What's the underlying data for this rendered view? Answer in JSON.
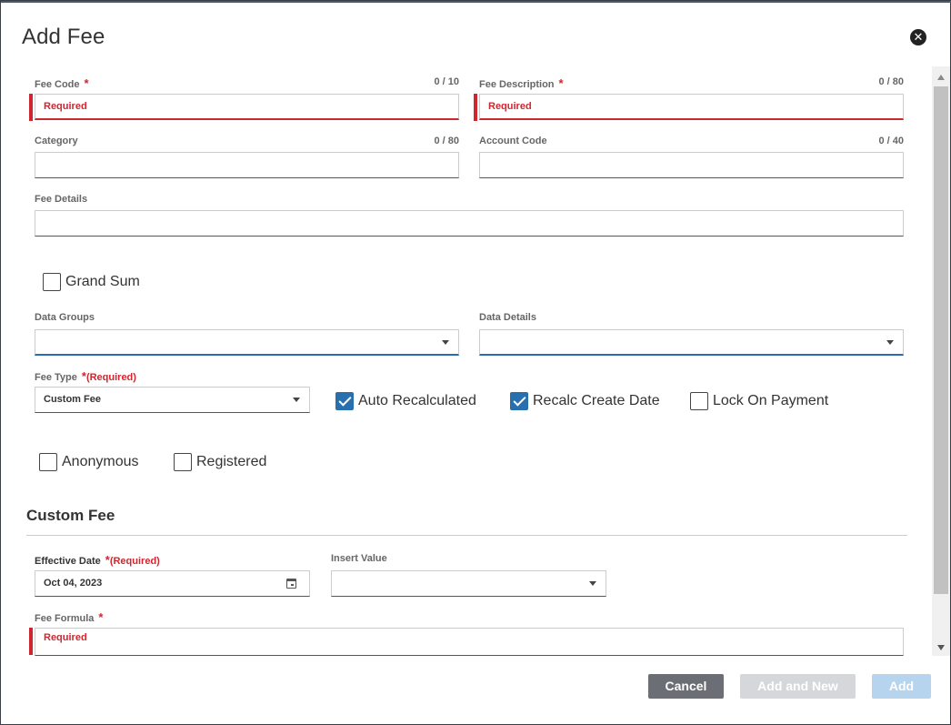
{
  "dialog": {
    "title": "Add Fee"
  },
  "fields": {
    "fee_code": {
      "label": "Fee Code",
      "counter": "0 / 10",
      "placeholder": "Required"
    },
    "fee_description": {
      "label": "Fee Description",
      "counter": "0 / 80",
      "placeholder": "Required"
    },
    "category": {
      "label": "Category",
      "counter": "0 / 80",
      "value": ""
    },
    "account_code": {
      "label": "Account Code",
      "counter": "0 / 40",
      "value": ""
    },
    "fee_details": {
      "label": "Fee Details",
      "value": ""
    },
    "data_groups": {
      "label": "Data Groups",
      "value": ""
    },
    "data_details": {
      "label": "Data Details",
      "value": ""
    },
    "fee_type": {
      "label": "Fee Type",
      "required_text": "(Required)",
      "value": "Custom Fee"
    }
  },
  "checkboxes": {
    "grand_sum": {
      "label": "Grand Sum",
      "checked": false
    },
    "auto_recalculated": {
      "label": "Auto Recalculated",
      "checked": true
    },
    "recalc_create_date": {
      "label": "Recalc Create Date",
      "checked": true
    },
    "lock_on_payment": {
      "label": "Lock On Payment",
      "checked": false
    },
    "anonymous": {
      "label": "Anonymous",
      "checked": false
    },
    "registered": {
      "label": "Registered",
      "checked": false
    }
  },
  "custom_fee": {
    "section_title": "Custom Fee",
    "effective_date": {
      "label": "Effective Date",
      "required_text": "(Required)",
      "value": "Oct 04, 2023"
    },
    "insert_value": {
      "label": "Insert Value",
      "value": ""
    },
    "fee_formula": {
      "label": "Fee Formula",
      "placeholder": "Required"
    }
  },
  "buttons": {
    "cancel": "Cancel",
    "add_and_new": "Add and New",
    "add": "Add"
  },
  "colors": {
    "error": "#d0262f",
    "checkbox_checked": "#2a6fad",
    "cancel_button": "#6b6e75",
    "add_button_disabled": "#b6d4ee"
  }
}
